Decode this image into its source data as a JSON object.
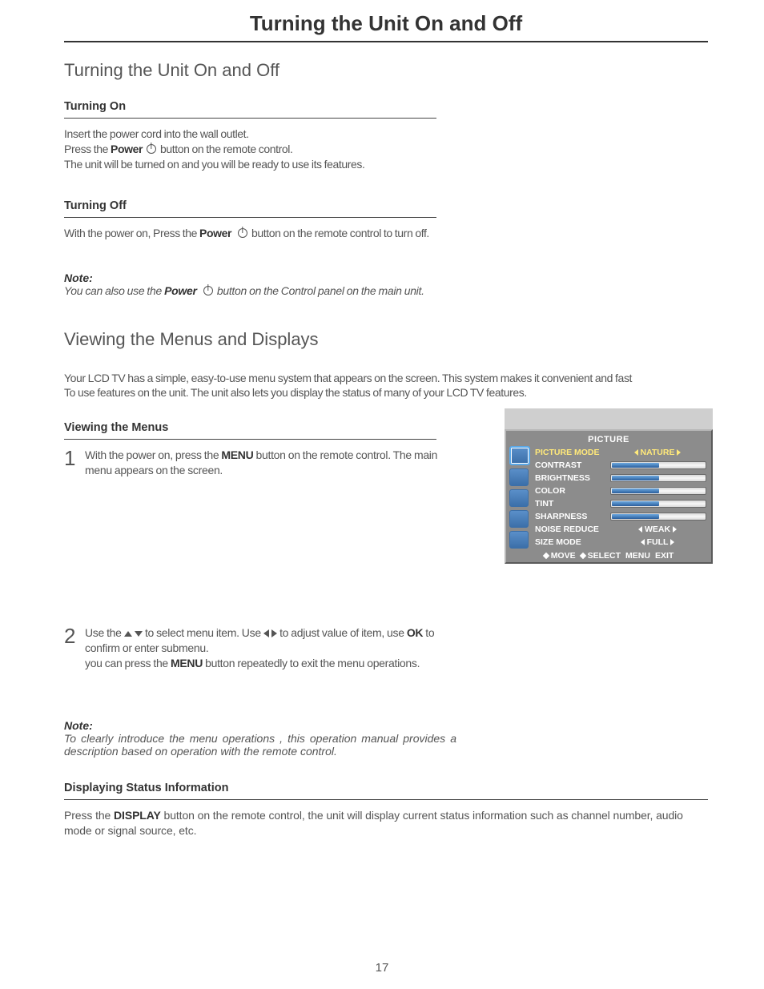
{
  "page_title": "Turning the Unit On and Off",
  "section1_h": "Turning the Unit On and Off",
  "turning_on_h": "Turning On",
  "turning_on_l1": "Insert the power cord into the wall outlet.",
  "turning_on_l2a": "Press the ",
  "turning_on_l2b": "Power",
  "turning_on_l2c": " button on the remote control.",
  "turning_on_l3": "The unit will be turned on and you will be ready to use its features.",
  "turning_off_h": "Turning Off",
  "turning_off_l1a": "With the power on, Press the ",
  "turning_off_l1b": "Power",
  "turning_off_l1c": " button on the remote control to turn off.",
  "note_label": "Note:",
  "note1_a": "You can also use the ",
  "note1_b": "Power",
  "note1_c": " button on the Control panel on the main unit.",
  "section2_h": "Viewing the Menus and Displays",
  "section2_p1": "Your LCD TV has a simple, easy-to-use menu system that appears on the screen. This system makes it convenient and fast",
  "section2_p2": "To use features on the unit. The unit also lets you display the status of many of your LCD TV features.",
  "viewing_menus_h": "Viewing the Menus",
  "step1_num": "1",
  "step1_a": "With the power on, press the ",
  "step1_b": "MENU",
  "step1_c": " button on the remote control. The main menu appears on the screen.",
  "step2_num": "2",
  "step2_a": "Use the ",
  "step2_b": " to select menu item. Use ",
  "step2_c": " to adjust value  of item, use ",
  "step2_d": "OK",
  "step2_e": " to confirm or enter submenu.",
  "step2_f": "you can press the ",
  "step2_g": "MENU",
  "step2_h": " button repeatedly to exit the menu operations.",
  "note2": "To clearly introduce the menu operations , this operation manual provides a description based on operation with the remote control.",
  "disp_status_h": "Displaying Status Information",
  "disp_status_a": "Press the ",
  "disp_status_b": "DISPLAY",
  "disp_status_c": " button on the remote control, the unit will display current status information such as channel number, audio mode or signal source, etc.",
  "page_number": "17",
  "osd": {
    "title": "PICTURE",
    "rows": [
      {
        "label": "PICTURE MODE",
        "type": "select",
        "value": "NATURE",
        "selected": true,
        "fill": 0
      },
      {
        "label": "CONTRAST",
        "type": "slider",
        "value": "",
        "selected": false,
        "fill": 50
      },
      {
        "label": "BRIGHTNESS",
        "type": "slider",
        "value": "",
        "selected": false,
        "fill": 50
      },
      {
        "label": "COLOR",
        "type": "slider",
        "value": "",
        "selected": false,
        "fill": 50
      },
      {
        "label": "TINT",
        "type": "slider",
        "value": "",
        "selected": false,
        "fill": 50
      },
      {
        "label": "SHARPNESS",
        "type": "slider",
        "value": "",
        "selected": false,
        "fill": 50
      },
      {
        "label": "NOISE REDUCE",
        "type": "select",
        "value": "WEAK",
        "selected": false,
        "fill": 0
      },
      {
        "label": "SIZE MODE",
        "type": "select",
        "value": "FULL",
        "selected": false,
        "fill": 0
      }
    ],
    "footer": {
      "move": "MOVE",
      "select": "SELECT",
      "menu": "MENU",
      "exit": "EXIT"
    }
  }
}
